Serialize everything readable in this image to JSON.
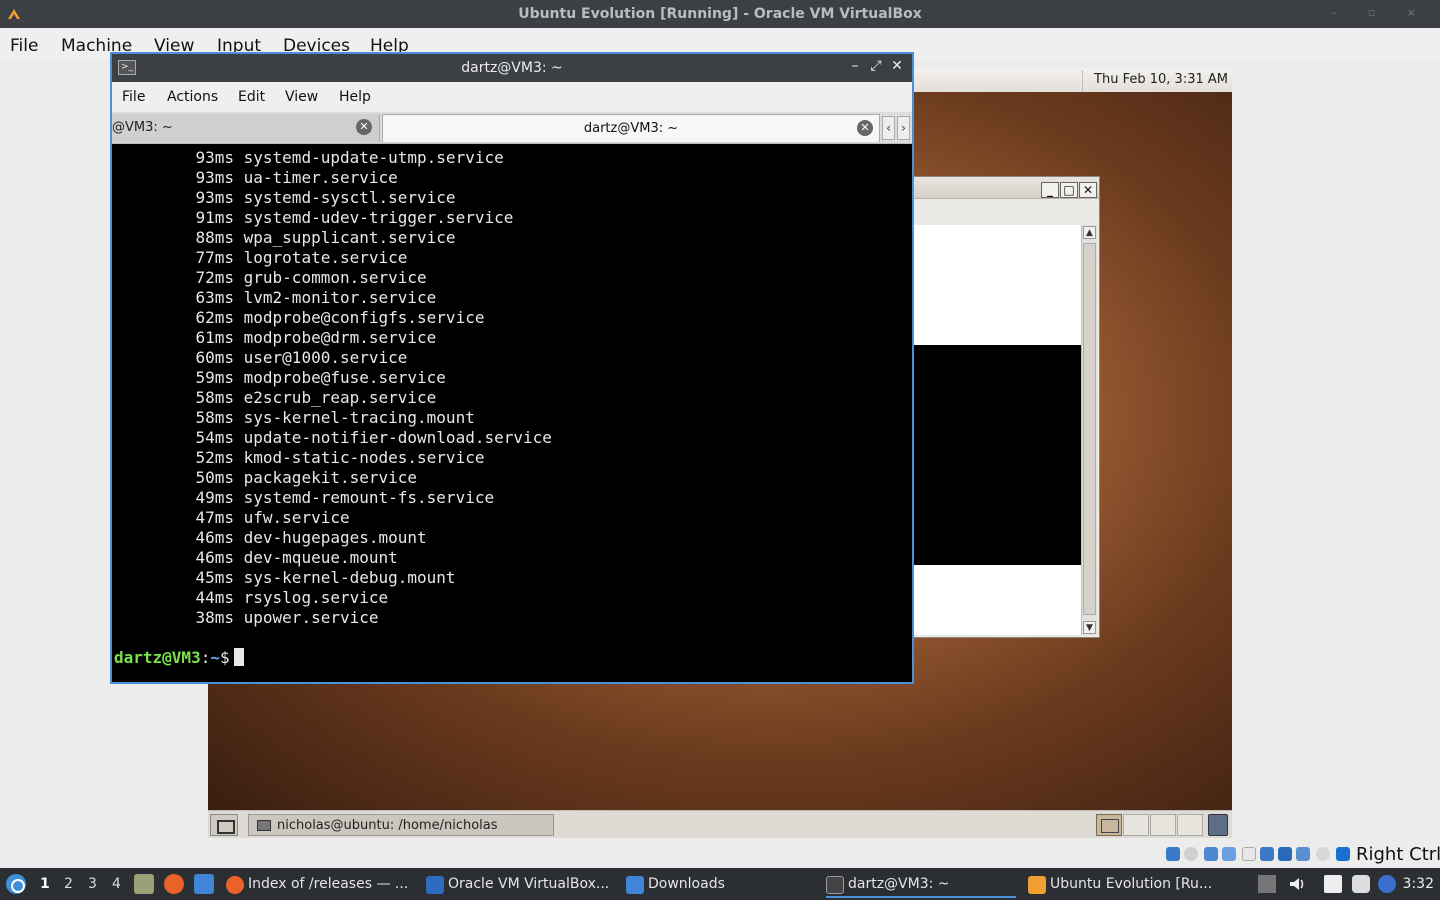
{
  "host": {
    "window_title": "Ubuntu Evolution [Running] - Oracle VM VirtualBox",
    "menu": [
      "File",
      "Machine",
      "View",
      "Input",
      "Devices",
      "Help"
    ],
    "right_ctrl": "Right Ctrl"
  },
  "guest": {
    "panel_clock": "Thu Feb 10,  3:31 AM",
    "taskbar_item": "nicholas@ubuntu: /home/nicholas"
  },
  "terminal": {
    "title": "dartz@VM3: ~",
    "menu": [
      "File",
      "Actions",
      "Edit",
      "View",
      "Help"
    ],
    "tabs": [
      "@VM3: ~",
      "dartz@VM3: ~"
    ],
    "lines": [
      {
        "time": "93ms",
        "unit": "systemd-update-utmp.service"
      },
      {
        "time": "93ms",
        "unit": "ua-timer.service"
      },
      {
        "time": "93ms",
        "unit": "systemd-sysctl.service"
      },
      {
        "time": "91ms",
        "unit": "systemd-udev-trigger.service"
      },
      {
        "time": "88ms",
        "unit": "wpa_supplicant.service"
      },
      {
        "time": "77ms",
        "unit": "logrotate.service"
      },
      {
        "time": "72ms",
        "unit": "grub-common.service"
      },
      {
        "time": "63ms",
        "unit": "lvm2-monitor.service"
      },
      {
        "time": "62ms",
        "unit": "modprobe@configfs.service"
      },
      {
        "time": "61ms",
        "unit": "modprobe@drm.service"
      },
      {
        "time": "60ms",
        "unit": "user@1000.service"
      },
      {
        "time": "59ms",
        "unit": "modprobe@fuse.service"
      },
      {
        "time": "58ms",
        "unit": "e2scrub_reap.service"
      },
      {
        "time": "58ms",
        "unit": "sys-kernel-tracing.mount"
      },
      {
        "time": "54ms",
        "unit": "update-notifier-download.service"
      },
      {
        "time": "52ms",
        "unit": "kmod-static-nodes.service"
      },
      {
        "time": "50ms",
        "unit": "packagekit.service"
      },
      {
        "time": "49ms",
        "unit": "systemd-remount-fs.service"
      },
      {
        "time": "47ms",
        "unit": "ufw.service"
      },
      {
        "time": "46ms",
        "unit": "dev-hugepages.mount"
      },
      {
        "time": "46ms",
        "unit": "dev-mqueue.mount"
      },
      {
        "time": "45ms",
        "unit": "sys-kernel-debug.mount"
      },
      {
        "time": "44ms",
        "unit": "rsyslog.service"
      },
      {
        "time": "38ms",
        "unit": "upower.service"
      }
    ],
    "prompt_user": "dartz@VM3",
    "prompt_sep": ":",
    "prompt_path": "~",
    "prompt_symbol": "$"
  },
  "taskbar": {
    "desktops": [
      "1",
      "2",
      "3",
      "4"
    ],
    "items": [
      {
        "label": "Index of /releases — ..."
      },
      {
        "label": "Oracle VM VirtualBox..."
      },
      {
        "label": "Downloads"
      },
      {
        "label": "dartz@VM3: ~"
      },
      {
        "label": "Ubuntu Evolution [Ru..."
      }
    ],
    "clock": "3:32"
  },
  "colors": {
    "prompt_user": "#7ae24a",
    "prompt_path": "#6aa8ff",
    "active_border": "#4a90d9"
  }
}
